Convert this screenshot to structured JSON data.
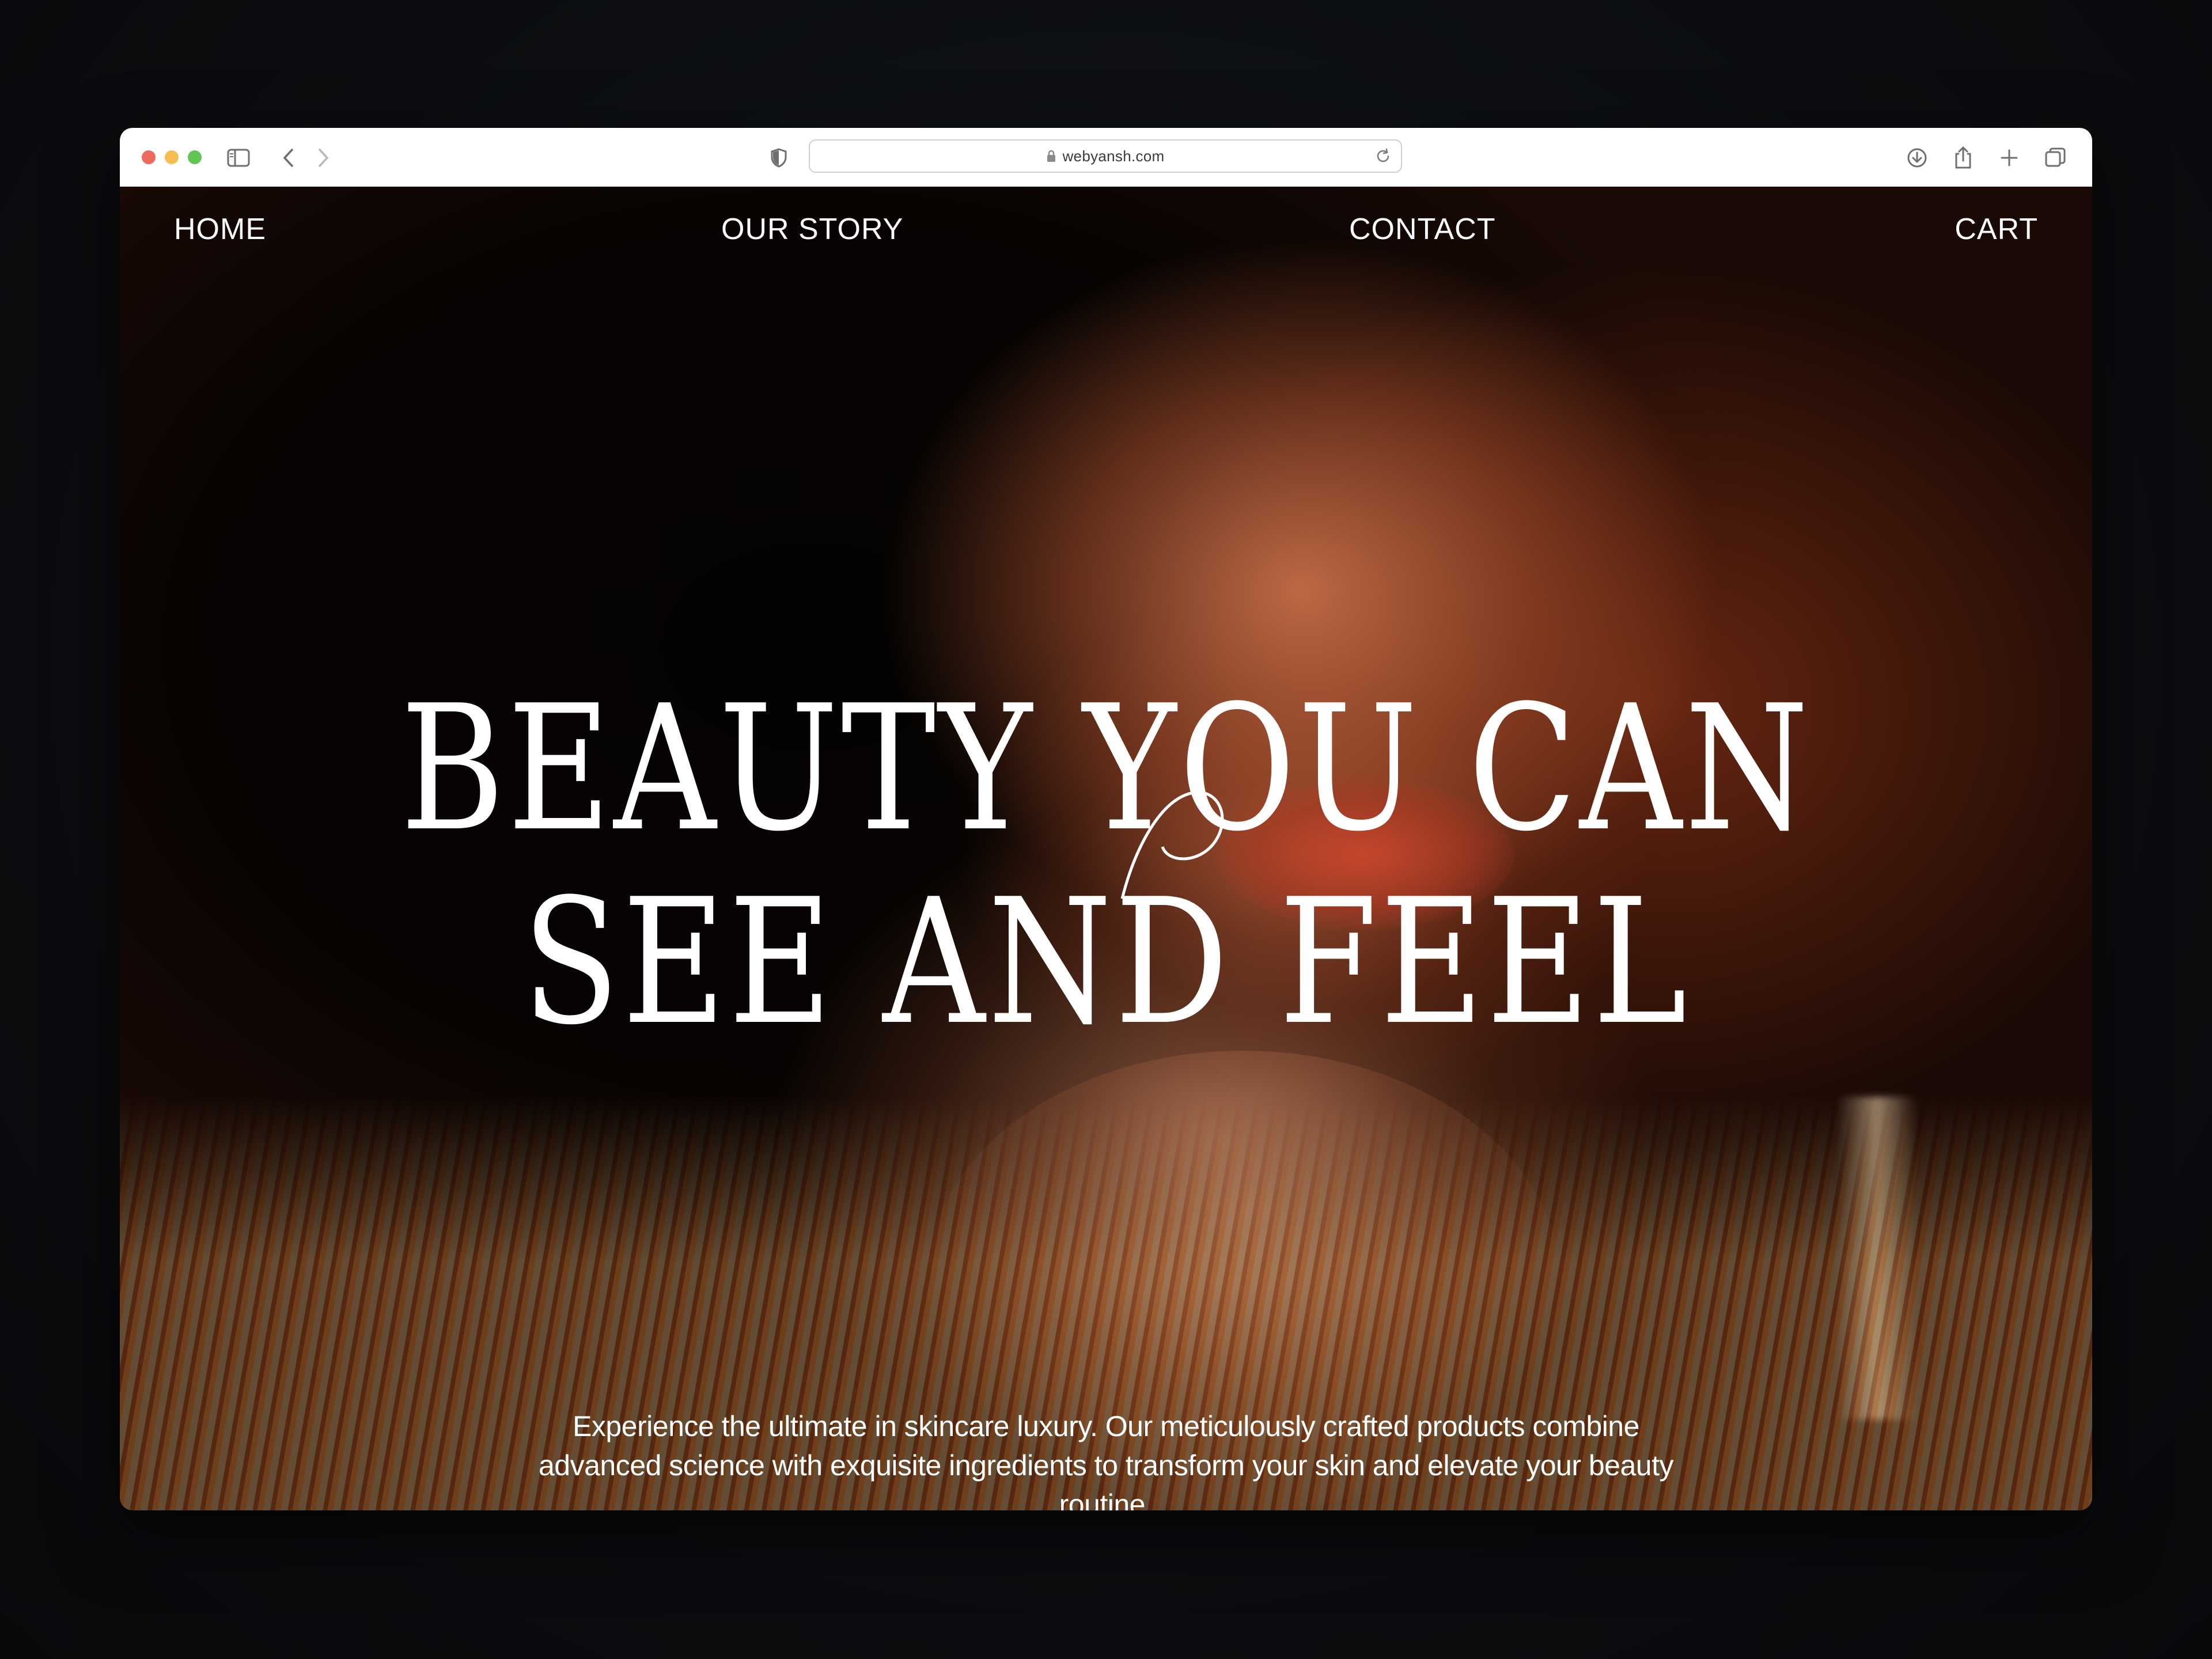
{
  "browser": {
    "url": "webyansh.com",
    "icons": [
      "sidebar-icon",
      "back-icon",
      "forward-icon",
      "shield-icon",
      "lock-icon",
      "reload-icon",
      "download-icon",
      "share-icon",
      "new-tab-icon",
      "tabs-overview-icon"
    ]
  },
  "nav": {
    "home": "HOME",
    "story": "OUR STORY",
    "contact": "CONTACT",
    "cart": "CART"
  },
  "hero": {
    "headline_line1": "BEAUTY YOU CAN",
    "headline_line2": "SEE AND FEEL",
    "subtext": "Experience the ultimate in skincare luxury. Our meticulously crafted products combine advanced science with exquisite ingredients to transform your skin and elevate your beauty routine.",
    "scroll_icon": "chevron-down-icon"
  },
  "colors": {
    "text": "#ffffff",
    "background": "#070403",
    "traffic_red": "#ed6a5e",
    "traffic_yellow": "#f5bf4f",
    "traffic_green": "#61c554"
  }
}
